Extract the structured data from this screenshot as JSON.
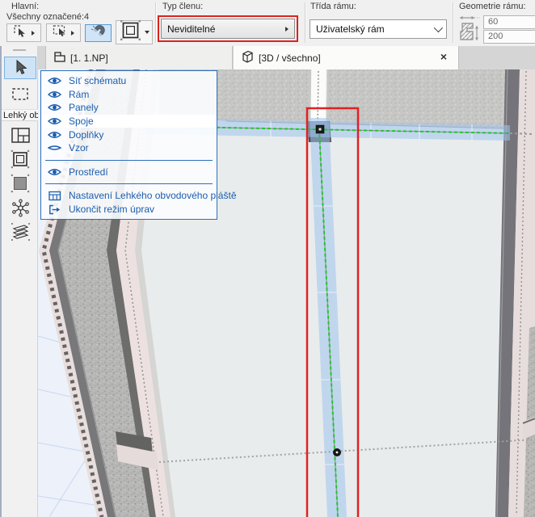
{
  "toolbar": {
    "main": {
      "label": "Hlavní:",
      "status": "Všechny označené:4",
      "buttons": [
        {
          "name": "select-arrow-flyout"
        },
        {
          "name": "marquee-select-flyout"
        },
        {
          "name": "magnet-toggle",
          "active": true
        },
        {
          "name": "selection-frame-dropdown"
        }
      ]
    },
    "member_type": {
      "label": "Typ členu:",
      "value": "Neviditelné",
      "highlighted": true
    },
    "frame_class": {
      "label": "Třída rámu:",
      "value": "Uživatelský rám"
    },
    "frame_geometry": {
      "label": "Geometrie rámu:",
      "width": "60",
      "depth": "200"
    }
  },
  "tabbar": {
    "tabs": [
      {
        "label": "[1. 1.NP]",
        "icon": "story-icon",
        "active": false
      },
      {
        "label": "[3D / všechno]",
        "icon": "3d-box-icon",
        "active": true,
        "close": "×"
      }
    ]
  },
  "side_toolbar": {
    "group_label": "Lehký ob"
  },
  "context_panel": {
    "items": [
      {
        "icon": "eye-open",
        "label": "Síť schématu"
      },
      {
        "icon": "eye-open",
        "label": "Rám"
      },
      {
        "icon": "eye-open",
        "label": "Panely"
      },
      {
        "icon": "eye-open",
        "label": "Spoje"
      },
      {
        "icon": "eye-open",
        "label": "Doplňky"
      },
      {
        "icon": "eye-closed",
        "label": "Vzor"
      },
      {
        "icon": "eye-open",
        "label": "Prostředí"
      },
      {
        "icon": "settings-grid",
        "label": "Nastavení Lehkého obvodového pláště"
      },
      {
        "icon": "exit",
        "label": "Ukončit režim úprav"
      }
    ]
  },
  "colors": {
    "accent_blue": "#1a5dad",
    "selection_red": "#e02222",
    "scheme_green": "#25c52f",
    "band_blue": "#9ec4ee",
    "active_button_bg": "#cfe4f7"
  }
}
